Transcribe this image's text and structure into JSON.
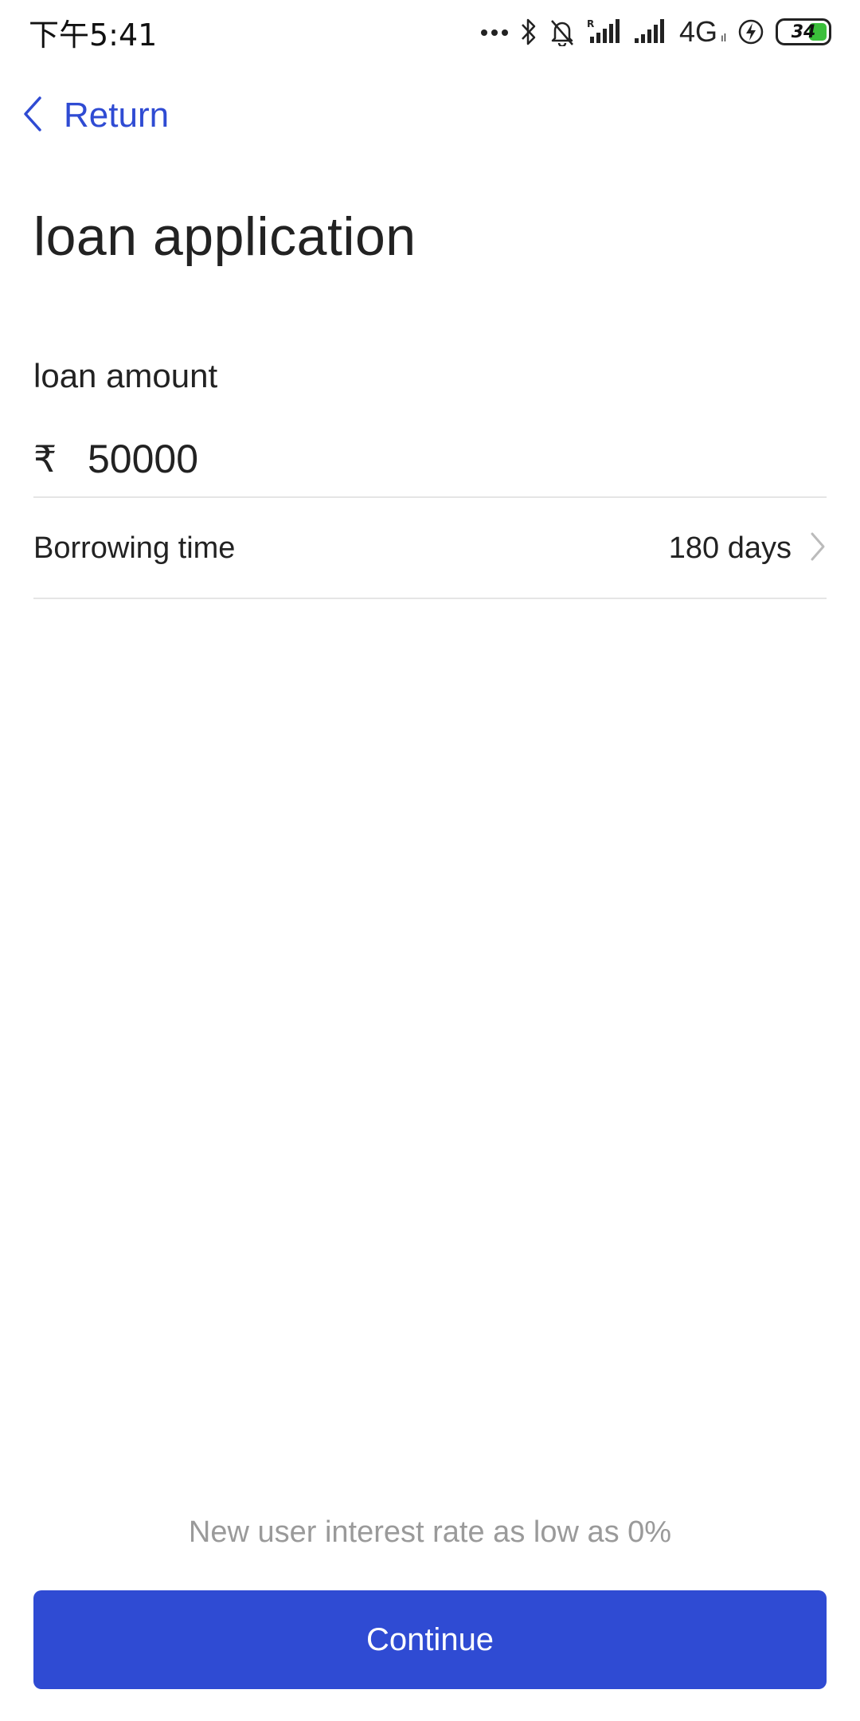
{
  "status_bar": {
    "time": "下午5:41",
    "network": "4G",
    "network_small": "ıl",
    "battery": "34",
    "icons": [
      "more-dots-icon",
      "bluetooth-icon",
      "bell-muted-icon",
      "signal-roaming-icon",
      "signal-icon",
      "charging-icon",
      "battery-icon"
    ],
    "battery_color": "#3bbf3b"
  },
  "nav": {
    "back_label": "Return",
    "back_icon": "chevron-left-icon",
    "accent_color": "#2f4bd3"
  },
  "page": {
    "title": "loan application"
  },
  "form": {
    "loan_amount_label": "loan amount",
    "currency_symbol": "₹",
    "loan_amount_value": "50000",
    "borrowing_time_label": "Borrowing time",
    "borrowing_time_value": "180 days",
    "chevron_icon": "chevron-right-icon"
  },
  "footer": {
    "promo_text": "New user interest rate as low as 0%",
    "continue_label": "Continue",
    "button_color": "#2f4bd3"
  }
}
